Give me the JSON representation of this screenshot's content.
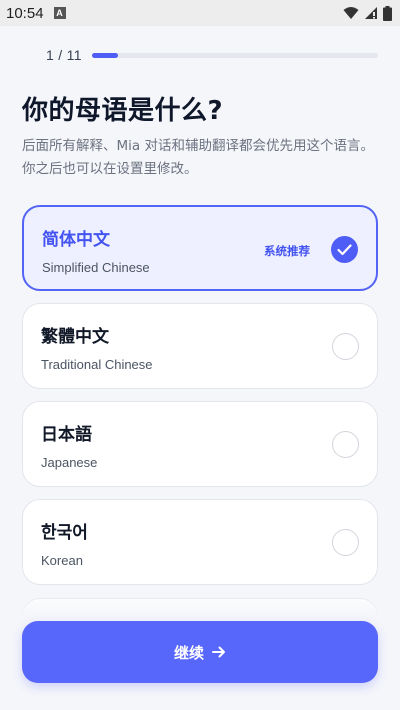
{
  "status_bar": {
    "time": "10:54",
    "notification_letter": "A"
  },
  "progress": {
    "text": "1 / 11",
    "current": 1,
    "total": 11
  },
  "title": "你的母语是什么?",
  "subtitle": "后面所有解释、Mia 对话和辅助翻译都会优先用这个语言。你之后也可以在设置里修改。",
  "options": [
    {
      "label": "简体中文",
      "sublabel": "Simplified Chinese",
      "badge": "系统推荐",
      "selected": true
    },
    {
      "label": "繁體中文",
      "sublabel": "Traditional Chinese",
      "selected": false
    },
    {
      "label": "日本語",
      "sublabel": "Japanese",
      "selected": false
    },
    {
      "label": "한국어",
      "sublabel": "Korean",
      "selected": false
    }
  ],
  "continue_button": {
    "label": "继续",
    "icon": "arrow-right-icon"
  },
  "colors": {
    "accent": "#4f5df7",
    "selected_bg": "#eef0ff",
    "button": "#5766fb"
  }
}
